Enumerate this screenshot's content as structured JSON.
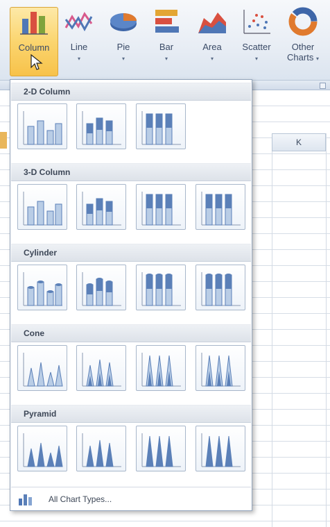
{
  "ribbon": {
    "buttons": [
      {
        "label": "Column",
        "icon": "column-chart-icon",
        "active": true,
        "dropdown": true
      },
      {
        "label": "Line",
        "icon": "line-chart-icon",
        "active": false,
        "dropdown": true
      },
      {
        "label": "Pie",
        "icon": "pie-chart-icon",
        "active": false,
        "dropdown": true
      },
      {
        "label": "Bar",
        "icon": "bar-chart-icon",
        "active": false,
        "dropdown": true
      },
      {
        "label": "Area",
        "icon": "area-chart-icon",
        "active": false,
        "dropdown": true
      },
      {
        "label": "Scatter",
        "icon": "scatter-chart-icon",
        "active": false,
        "dropdown": true
      },
      {
        "label": "Other",
        "label2": "Charts",
        "icon": "other-charts-icon",
        "active": false,
        "dropdown": true
      }
    ],
    "dropdown_caret": "▾"
  },
  "sheet": {
    "column_label": "K"
  },
  "gallery": {
    "sections": [
      {
        "title": "2-D Column",
        "thumbs": [
          "clustered-column",
          "stacked-column",
          "100-stacked-column"
        ]
      },
      {
        "title": "3-D Column",
        "thumbs": [
          "3d-clustered-column",
          "3d-stacked-column",
          "3d-100-stacked-column",
          "3d-column"
        ]
      },
      {
        "title": "Cylinder",
        "thumbs": [
          "clustered-cylinder",
          "stacked-cylinder",
          "100-stacked-cylinder",
          "3d-cylinder"
        ]
      },
      {
        "title": "Cone",
        "thumbs": [
          "clustered-cone",
          "stacked-cone",
          "100-stacked-cone",
          "3d-cone"
        ]
      },
      {
        "title": "Pyramid",
        "thumbs": [
          "clustered-pyramid",
          "stacked-pyramid",
          "100-stacked-pyramid",
          "3d-pyramid"
        ]
      }
    ],
    "footer": {
      "label": "All Chart Types...",
      "icon": "all-chart-types-icon"
    }
  },
  "colors": {
    "active_button": "#fbd56f",
    "chart_blue": "#5b80b8",
    "chart_light": "#b9cde6"
  }
}
